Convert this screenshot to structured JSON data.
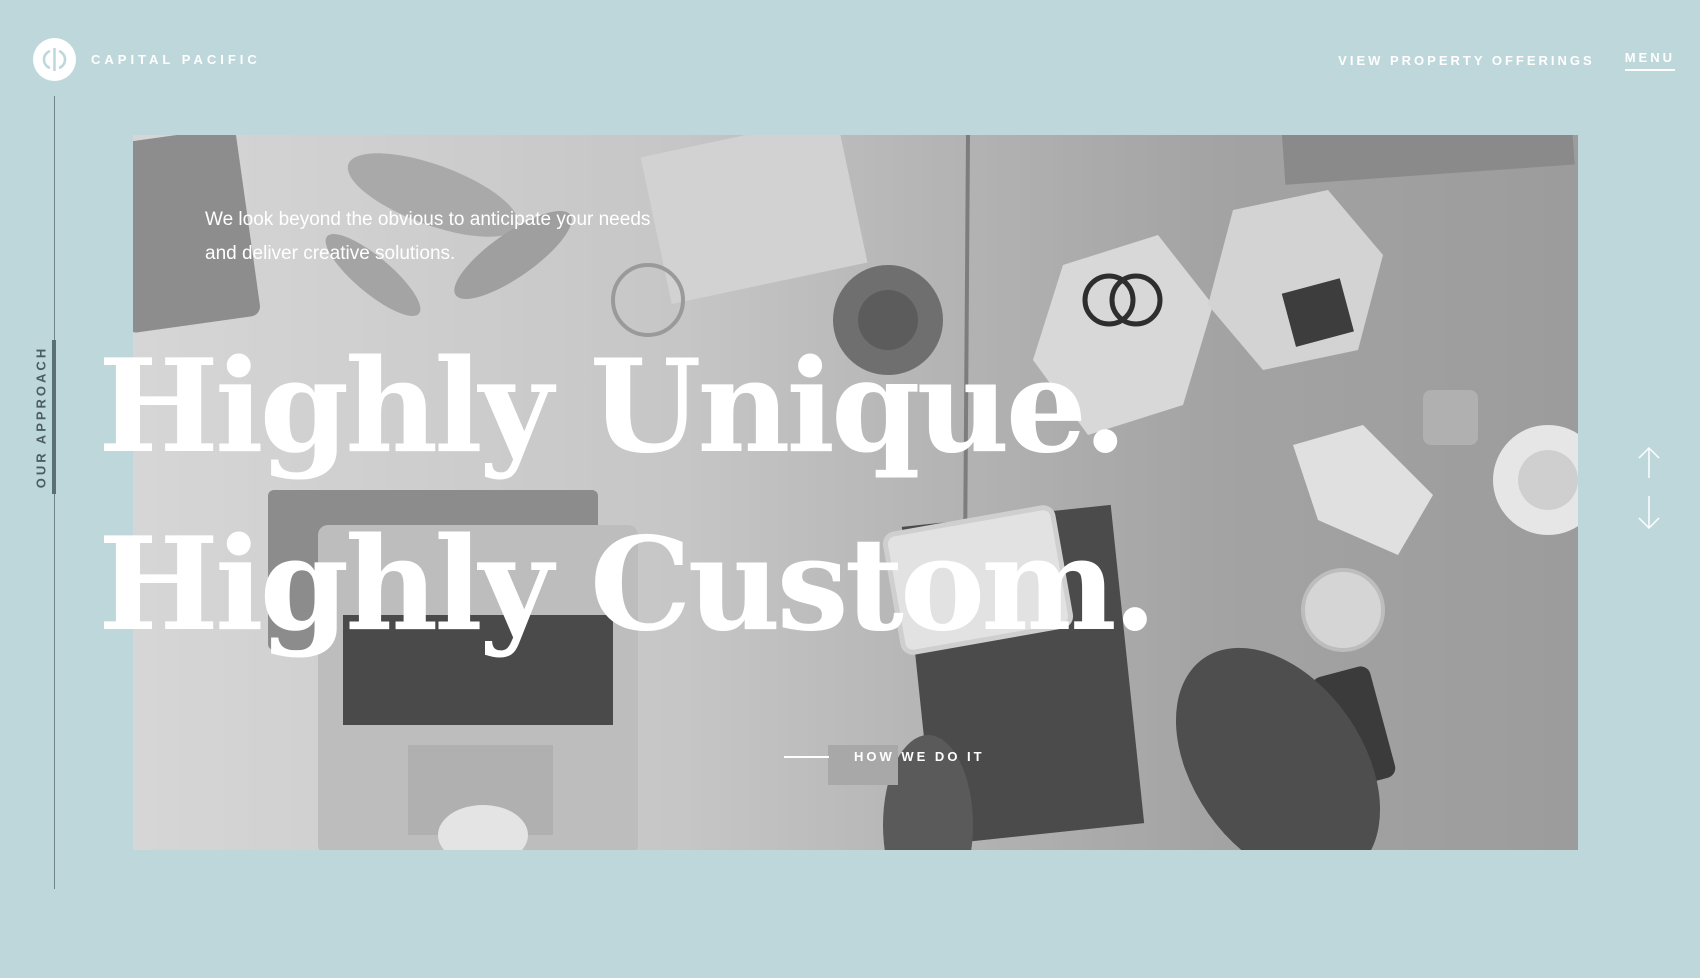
{
  "brand": {
    "name": "CAPITAL PACIFIC",
    "logo_icon": "cp-monogram-icon"
  },
  "nav": {
    "offerings_label": "VIEW PROPERTY OFFERINGS",
    "menu_label": "MENU"
  },
  "sidebar": {
    "section_label": "OUR APPROACH"
  },
  "hero": {
    "intro_text": "We look beyond the obvious to anticipate your needs and deliver creative solutions.",
    "headline_line1": "Highly Unique.",
    "headline_line2": "Highly Custom.",
    "cta_label": "HOW WE DO IT"
  },
  "scroll": {
    "up_icon": "arrow-up-icon",
    "down_icon": "arrow-down-icon"
  },
  "colors": {
    "background": "#bed7db",
    "text": "#ffffff",
    "rail": "#5a6f73"
  }
}
